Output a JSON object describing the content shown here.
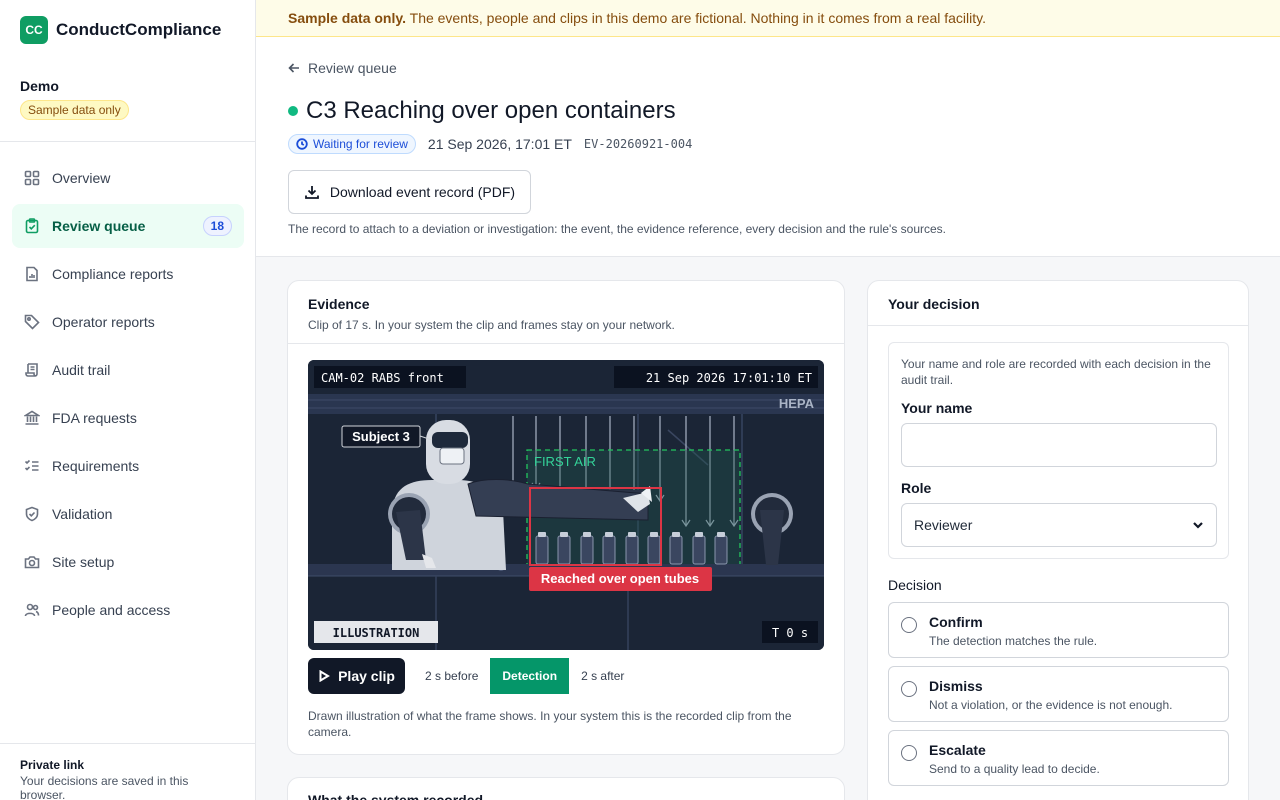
{
  "brand": {
    "logo_text": "CC",
    "name": "ConductCompliance"
  },
  "org": {
    "name": "Demo",
    "badge": "Sample data only"
  },
  "nav": [
    {
      "label": "Overview",
      "icon": "grid-icon"
    },
    {
      "label": "Review queue",
      "icon": "clipboard-check-icon",
      "count": "18",
      "active": true
    },
    {
      "label": "Compliance reports",
      "icon": "report-icon"
    },
    {
      "label": "Operator reports",
      "icon": "tag-icon"
    },
    {
      "label": "Audit trail",
      "icon": "scroll-icon"
    },
    {
      "label": "FDA requests",
      "icon": "bank-icon"
    },
    {
      "label": "Requirements",
      "icon": "checklist-icon"
    },
    {
      "label": "Validation",
      "icon": "shield-check-icon"
    },
    {
      "label": "Site setup",
      "icon": "camera-icon"
    },
    {
      "label": "People and access",
      "icon": "users-icon"
    }
  ],
  "sidebar_footer": {
    "title": "Private link",
    "subtitle": "Your decisions are saved in this browser."
  },
  "banner": {
    "bold": "Sample data only.",
    "text": " The events, people and clips in this demo are fictional. Nothing in it comes from a real facility."
  },
  "header": {
    "back_label": "Review queue",
    "title": "C3 Reaching over open containers",
    "status": "Waiting for review",
    "time": "21 Sep 2026, 17:01 ET",
    "event_id": "EV-20260921-004",
    "download_label": "Download event record (PDF)",
    "download_note": "The record to attach to a deviation or investigation: the event, the evidence reference, every decision and the rule's sources."
  },
  "evidence": {
    "title": "Evidence",
    "subtitle": "Clip of 17 s. In your system the clip and frames stay on your network.",
    "frame": {
      "camera": "CAM-02 RABS front",
      "timestamp": "21 Sep 2026 17:01:10 ET",
      "hepa": "HEPA",
      "subject": "Subject 3",
      "first_air": "FIRST AIR",
      "detection": "Reached over open tubes",
      "illustration": "ILLUSTRATION",
      "offset": "T 0 s"
    },
    "play_label": "Play clip",
    "segments": [
      "2 s before",
      "Detection",
      "2 s after"
    ],
    "note": "Drawn illustration of what the frame shows. In your system this is the recorded clip from the camera."
  },
  "recorded": {
    "title": "What the system recorded"
  },
  "decision": {
    "title": "Your decision",
    "help": "Your name and role are recorded with each decision in the audit trail.",
    "name_label": "Your name",
    "name_value": "",
    "role_label": "Role",
    "role_value": "Reviewer",
    "decision_label": "Decision",
    "options": [
      {
        "title": "Confirm",
        "desc": "The detection matches the rule."
      },
      {
        "title": "Dismiss",
        "desc": "Not a violation, or the evidence is not enough."
      },
      {
        "title": "Escalate",
        "desc": "Send to a quality lead to decide."
      }
    ]
  },
  "colors": {
    "brand": "#0f9d63",
    "detection": "#dc3545",
    "first_air": "#22c55e",
    "status": "#1d4ed8"
  }
}
